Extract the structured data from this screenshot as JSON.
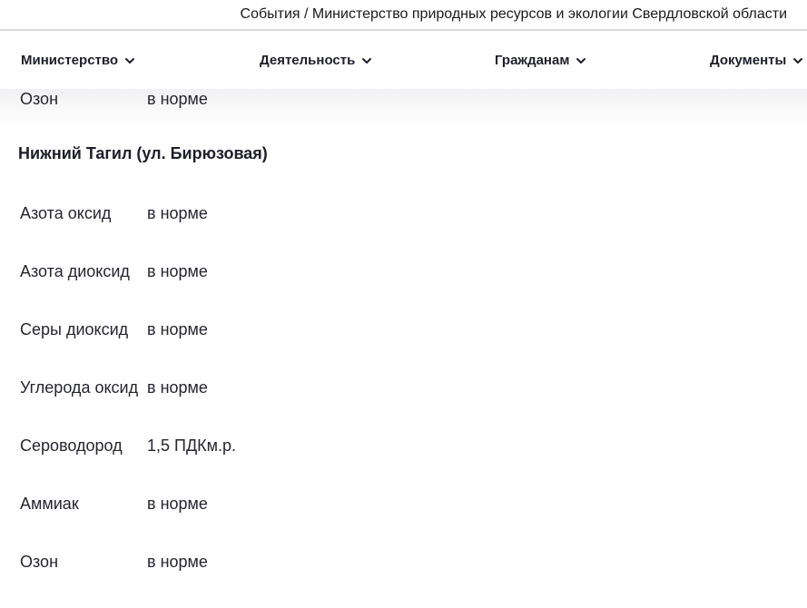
{
  "window": {
    "title": "События / Министерство природных ресурсов и экологии Свердловской области"
  },
  "nav": {
    "items": [
      {
        "label": "Министерство",
        "icon": "chevron-down-icon"
      },
      {
        "label": "Деятельность",
        "icon": "chevron-down-icon"
      },
      {
        "label": "Гражданам",
        "icon": "chevron-down-icon"
      },
      {
        "label": "Документы",
        "icon": "chevron-down-icon"
      }
    ]
  },
  "content": {
    "previous_row": {
      "param": "Озон",
      "value": "в норме"
    },
    "section_title": "Нижний Тагил (ул. Бирюзовая)",
    "rows": [
      {
        "param": "Азота оксид",
        "value": "в норме"
      },
      {
        "param": "Азота диоксид",
        "value": "в норме"
      },
      {
        "param": "Серы диоксид",
        "value": "в норме"
      },
      {
        "param": "Углерода оксид",
        "value": "в норме"
      },
      {
        "param": "Сероводород",
        "value": "1,5 ПДКм.р."
      },
      {
        "param": "Аммиак",
        "value": "в норме"
      },
      {
        "param": "Озон",
        "value": "в норме"
      }
    ]
  }
}
